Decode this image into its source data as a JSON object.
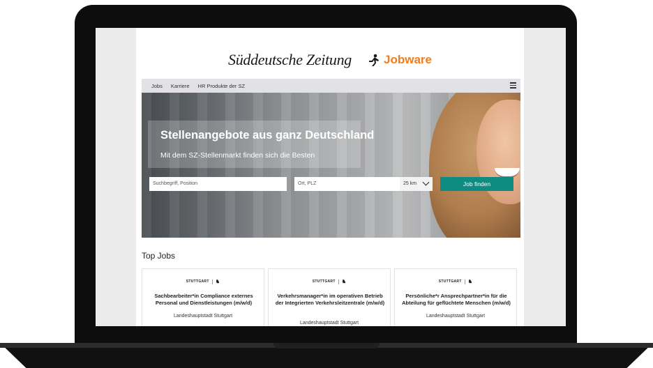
{
  "brand": {
    "sz_logo": "Süddeutsche Zeitung",
    "jobware": "Jobware",
    "jobware_color": "#f07d1f"
  },
  "nav": {
    "items": [
      "Jobs",
      "Karriere",
      "HR Produkte der SZ"
    ],
    "menu_icon": "hamburger-icon"
  },
  "hero": {
    "title": "Stellenangebote aus ganz Deutschland",
    "subtitle": "Mit dem SZ-Stellenmarkt finden sich die Besten"
  },
  "search": {
    "keyword_placeholder": "Suchbegriff, Position",
    "location_placeholder": "Ort, PLZ",
    "radius": "25 km",
    "button": "Job finden",
    "button_color": "#0f8c82"
  },
  "top_jobs": {
    "heading": "Top Jobs",
    "cards": [
      {
        "logo": "STUTTGART",
        "title": "Sachbearbeiter*in Compliance externes Personal und Dienstleistungen (m/w/d)",
        "employer": "Landeshauptstadt Stuttgart"
      },
      {
        "logo": "STUTTGART",
        "title": "Verkehrsmanager*in im operativen Betrieb der Integrierten Verkehrsleitzentrale (m/w/d)",
        "employer": "Landeshauptstadt Stuttgart"
      },
      {
        "logo": "STUTTGART",
        "title": "Persönliche*r Ansprechpartner*in für die Abteilung für geflüchtete Menschen (m/w/d)",
        "employer": "Landeshauptstadt Stuttgart"
      }
    ]
  }
}
